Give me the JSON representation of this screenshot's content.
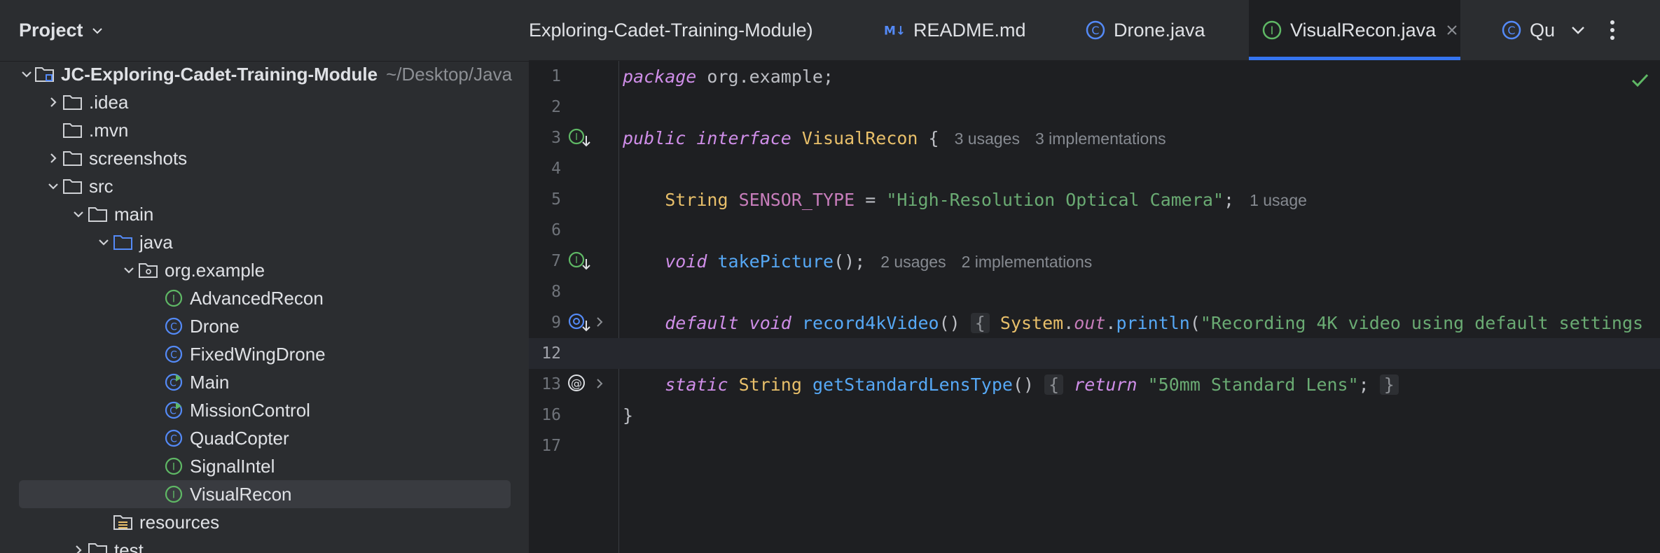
{
  "project_panel": {
    "title": "Project",
    "tree": [
      {
        "label": "JC-Exploring-Cadet-Training-Module",
        "hint": "~/Desktop/Java",
        "icon": "module-folder-icon",
        "arrow": "down",
        "indent": 0,
        "bold": true
      },
      {
        "label": ".idea",
        "icon": "folder-icon",
        "arrow": "right",
        "indent": 1
      },
      {
        "label": ".mvn",
        "icon": "folder-icon",
        "arrow": "none",
        "indent": 1
      },
      {
        "label": "screenshots",
        "icon": "folder-icon",
        "arrow": "right",
        "indent": 1
      },
      {
        "label": "src",
        "icon": "folder-icon",
        "arrow": "down",
        "indent": 1
      },
      {
        "label": "main",
        "icon": "folder-icon",
        "arrow": "down",
        "indent": 2
      },
      {
        "label": "java",
        "icon": "source-folder-icon",
        "arrow": "down",
        "indent": 3
      },
      {
        "label": "org.example",
        "icon": "package-icon",
        "arrow": "down",
        "indent": 4
      },
      {
        "label": "AdvancedRecon",
        "icon": "interface-icon",
        "arrow": "none",
        "indent": 5
      },
      {
        "label": "Drone",
        "icon": "class-icon",
        "arrow": "none",
        "indent": 5
      },
      {
        "label": "FixedWingDrone",
        "icon": "class-icon",
        "arrow": "none",
        "indent": 5
      },
      {
        "label": "Main",
        "icon": "runnable-class-icon",
        "arrow": "none",
        "indent": 5
      },
      {
        "label": "MissionControl",
        "icon": "runnable-class-icon",
        "arrow": "none",
        "indent": 5
      },
      {
        "label": "QuadCopter",
        "icon": "class-icon",
        "arrow": "none",
        "indent": 5
      },
      {
        "label": "SignalIntel",
        "icon": "interface-icon",
        "arrow": "none",
        "indent": 5
      },
      {
        "label": "VisualRecon",
        "icon": "interface-icon",
        "arrow": "none",
        "indent": 5,
        "selected": true
      },
      {
        "label": "resources",
        "icon": "resources-folder-icon",
        "arrow": "none",
        "indent": 3
      },
      {
        "label": "test",
        "icon": "folder-icon",
        "arrow": "right",
        "indent": 2
      }
    ]
  },
  "tabs": [
    {
      "label": "Exploring-Cadet-Training-Module)",
      "icon": "none"
    },
    {
      "label": "README.md",
      "icon": "markdown-icon"
    },
    {
      "label": "Drone.java",
      "icon": "class-icon"
    },
    {
      "label": "VisualRecon.java",
      "icon": "interface-icon",
      "active": true,
      "closable": true
    },
    {
      "label": "Qua",
      "icon": "class-icon"
    }
  ],
  "editor": {
    "line_numbers": [
      "1",
      "2",
      "3",
      "4",
      "5",
      "6",
      "7",
      "8",
      "9",
      "12",
      "13",
      "16",
      "17"
    ],
    "tokens": {
      "package_kw": "package",
      "package_name": "org.example",
      "semi": ";",
      "public_kw": "public",
      "interface_kw": "interface",
      "interface_name": "VisualRecon",
      "open_brace": "{",
      "close_brace": "}",
      "string_type": "String",
      "const_name": "SENSOR_TYPE",
      "assign": "=",
      "sensor_value": "\"High-Resolution Optical Camera\"",
      "void_kw": "void",
      "take_picture": "takePicture",
      "parens": "()",
      "default_kw": "default",
      "record_video": "record4kVideo",
      "system": "System",
      "dot": ".",
      "out": "out",
      "println": "println",
      "open_paren": "(",
      "record_msg": "\"Recording 4K video using default settings",
      "static_kw": "static",
      "get_lens": "getStandardLensType",
      "return_kw": "return",
      "lens_value": "\"50mm Standard Lens\""
    },
    "hints": {
      "interface_usages": "3 usages",
      "interface_impls": "3 implementations",
      "const_usages": "1 usage",
      "method_usages": "2 usages",
      "method_impls": "2 implementations"
    }
  }
}
